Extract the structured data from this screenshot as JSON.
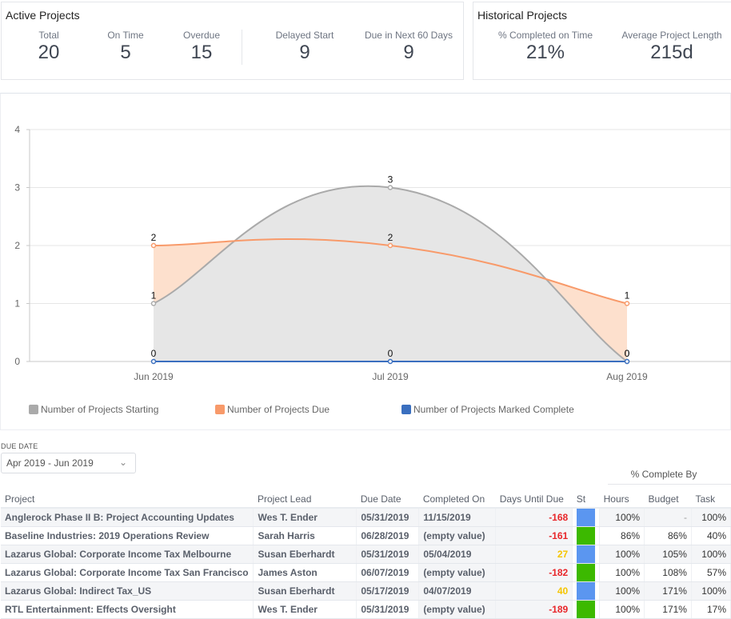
{
  "active_projects": {
    "title": "Active Projects",
    "kpis": [
      {
        "label": "Total",
        "value": "20"
      },
      {
        "label": "On Time",
        "value": "5"
      },
      {
        "label": "Overdue",
        "value": "15"
      },
      {
        "label": "Delayed Start",
        "value": "9"
      },
      {
        "label": "Due in Next 60 Days",
        "value": "9"
      }
    ]
  },
  "historical_projects": {
    "title": "Historical Projects",
    "kpis": [
      {
        "label": "% Completed on Time",
        "value": "21%"
      },
      {
        "label": "Average Project Length",
        "value": "215d"
      }
    ]
  },
  "chart_data": {
    "type": "area",
    "categories": [
      "Jun 2019",
      "Jul 2019",
      "Aug 2019"
    ],
    "series": [
      {
        "name": "Number of Projects Starting",
        "values": [
          1,
          3,
          0
        ],
        "color": "#aaaaaa",
        "fill": "#e6e6e6"
      },
      {
        "name": "Number of Projects Due",
        "values": [
          2,
          2,
          1
        ],
        "color": "#f89a6a",
        "fill": "#fde0cd"
      },
      {
        "name": "Number of Projects Marked Complete",
        "values": [
          0,
          0,
          0
        ],
        "color": "#3a6fbf",
        "fill": "none"
      }
    ],
    "y_ticks": [
      "0",
      "1",
      "2",
      "3",
      "4"
    ],
    "ylim": [
      0,
      4
    ],
    "grid": true,
    "legend": "bottom",
    "title": "",
    "xlabel": "",
    "ylabel": ""
  },
  "filter": {
    "label": "DUE DATE",
    "value": "Apr 2019 - Jun 2019"
  },
  "table": {
    "group_header": "% Complete By",
    "columns": [
      "Project",
      "Project Lead",
      "Due Date",
      "Completed On",
      "Days Until Due",
      "St",
      "Hours",
      "Budget",
      "Task"
    ],
    "status_colors": {
      "blue": "#5b96f0",
      "green": "#3cb900"
    },
    "days_colors": {
      "red": "#e8262a",
      "yellow": "#f5c500"
    },
    "rows": [
      {
        "project": "Anglerock Phase II B: Project Accounting Updates",
        "lead": "Wes T. Ender",
        "due": "05/31/2019",
        "completed": "11/15/2019",
        "days": "-168",
        "days_color": "red",
        "status": "blue",
        "hours": "100%",
        "budget": "-",
        "task": "100%"
      },
      {
        "project": "Baseline Industries: 2019 Operations Review",
        "lead": "Sarah Harris",
        "due": "06/28/2019",
        "completed": "(empty value)",
        "days": "-161",
        "days_color": "red",
        "status": "green",
        "hours": "86%",
        "budget": "86%",
        "task": "40%"
      },
      {
        "project": "Lazarus Global: Corporate Income Tax Melbourne",
        "lead": "Susan Eberhardt",
        "due": "05/31/2019",
        "completed": "05/04/2019",
        "days": "27",
        "days_color": "yellow",
        "status": "blue",
        "hours": "100%",
        "budget": "105%",
        "task": "100%"
      },
      {
        "project": "Lazarus Global: Corporate Income Tax San Francisco",
        "lead": "James Aston",
        "due": "06/07/2019",
        "completed": "(empty value)",
        "days": "-182",
        "days_color": "red",
        "status": "green",
        "hours": "100%",
        "budget": "108%",
        "task": "57%"
      },
      {
        "project": "Lazarus Global: Indirect Tax_US",
        "lead": "Susan Eberhardt",
        "due": "05/17/2019",
        "completed": "04/07/2019",
        "days": "40",
        "days_color": "yellow",
        "status": "blue",
        "hours": "100%",
        "budget": "171%",
        "task": "100%"
      },
      {
        "project": "RTL Entertainment: Effects Oversight",
        "lead": "Wes T. Ender",
        "due": "05/31/2019",
        "completed": "(empty value)",
        "days": "-189",
        "days_color": "red",
        "status": "green",
        "hours": "100%",
        "budget": "171%",
        "task": "17%"
      }
    ]
  }
}
